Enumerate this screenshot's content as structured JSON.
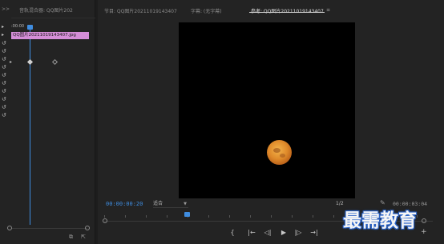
{
  "left_panel": {
    "tabs": [
      ">>",
      "音轨混合器: QQ图片202"
    ],
    "ruler_time": ":00:00",
    "clip_label": "QQ图片20211019143407.jpg",
    "row_icon": "reset-icon",
    "row_count": 11
  },
  "right_panel": {
    "tabs": [
      "节目: QQ图片20211019143407",
      "字幕: (无字幕)",
      "参考: QQ图片20211019143407"
    ],
    "menu_icon": "≡",
    "timecode_current": "00:00:00:20",
    "fit_value": "适合",
    "resolution_value": "1/2",
    "timecode_duration": "00:00:03:04",
    "transport": {
      "mark_in": "{",
      "go_to_in": "|←",
      "step_back": "◁|",
      "play": "▶",
      "step_forward": "|▷",
      "go_to_out": "→|"
    },
    "add_label": "+"
  },
  "watermark": "最需教育",
  "colors": {
    "accent_blue": "#3f8de0",
    "clip_pink": "#d58ed8",
    "moon_orange": "#df8a2a",
    "panel_bg": "#232323"
  }
}
